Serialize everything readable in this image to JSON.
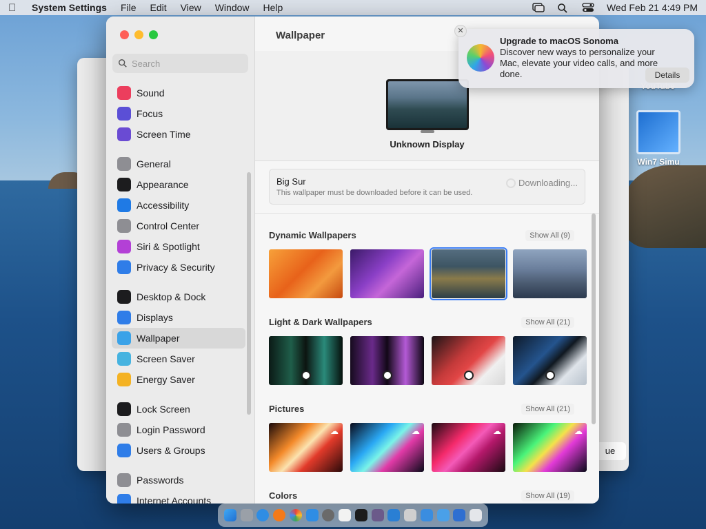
{
  "menubar": {
    "app_name": "System Settings",
    "menus": [
      "File",
      "Edit",
      "View",
      "Window",
      "Help"
    ],
    "clock": "Wed Feb 21  4:49 PM"
  },
  "desktop": {
    "icons": [
      {
        "label": "YouTube"
      },
      {
        "label": "Win7 Simu"
      }
    ]
  },
  "background_window": {
    "button_label": "ue"
  },
  "sidebar": {
    "search_placeholder": "Search",
    "groups": [
      [
        {
          "label": "Sound",
          "icon": "sound-icon",
          "color": "#ec3e5d"
        },
        {
          "label": "Focus",
          "icon": "moon-icon",
          "color": "#5b4fd6"
        },
        {
          "label": "Screen Time",
          "icon": "hourglass-icon",
          "color": "#6a4bd3"
        }
      ],
      [
        {
          "label": "General",
          "icon": "gear-icon",
          "color": "#8e8e93"
        },
        {
          "label": "Appearance",
          "icon": "appearance-icon",
          "color": "#1c1c1e"
        },
        {
          "label": "Accessibility",
          "icon": "accessibility-icon",
          "color": "#1f7ae5"
        },
        {
          "label": "Control Center",
          "icon": "toggles-icon",
          "color": "#8e8e93"
        },
        {
          "label": "Siri & Spotlight",
          "icon": "siri-icon",
          "color": "#b340d6"
        },
        {
          "label": "Privacy & Security",
          "icon": "hand-icon",
          "color": "#2f7de8"
        }
      ],
      [
        {
          "label": "Desktop & Dock",
          "icon": "dock-icon",
          "color": "#1c1c1e"
        },
        {
          "label": "Displays",
          "icon": "sun-icon",
          "color": "#2f7de8"
        },
        {
          "label": "Wallpaper",
          "icon": "flower-icon",
          "color": "#3aa2e8",
          "selected": true
        },
        {
          "label": "Screen Saver",
          "icon": "screen-saver-icon",
          "color": "#46b3e0"
        },
        {
          "label": "Energy Saver",
          "icon": "lightbulb-icon",
          "color": "#f4b223"
        }
      ],
      [
        {
          "label": "Lock Screen",
          "icon": "lock-icon",
          "color": "#1c1c1e"
        },
        {
          "label": "Login Password",
          "icon": "padlock-icon",
          "color": "#8e8e93"
        },
        {
          "label": "Users & Groups",
          "icon": "users-icon",
          "color": "#2f7de8"
        }
      ],
      [
        {
          "label": "Passwords",
          "icon": "key-icon",
          "color": "#8e8e93"
        },
        {
          "label": "Internet Accounts",
          "icon": "at-icon",
          "color": "#2f7de8"
        }
      ]
    ]
  },
  "content": {
    "title": "Wallpaper",
    "display_label": "Unknown Display",
    "current": {
      "name": "Big Sur",
      "subtitle": "This wallpaper must be downloaded before it can be used.",
      "status": "Downloading..."
    },
    "sections": [
      {
        "title": "Dynamic Wallpapers",
        "show_all": "Show All (9)"
      },
      {
        "title": "Light & Dark Wallpapers",
        "show_all": "Show All (21)"
      },
      {
        "title": "Pictures",
        "show_all": "Show All (21)"
      },
      {
        "title": "Colors",
        "show_all": "Show All (19)"
      }
    ]
  },
  "notification": {
    "title": "Upgrade to macOS Sonoma",
    "body": "Discover new ways to personalize your Mac, elevate your video calls, and more done.",
    "button": "Details"
  }
}
